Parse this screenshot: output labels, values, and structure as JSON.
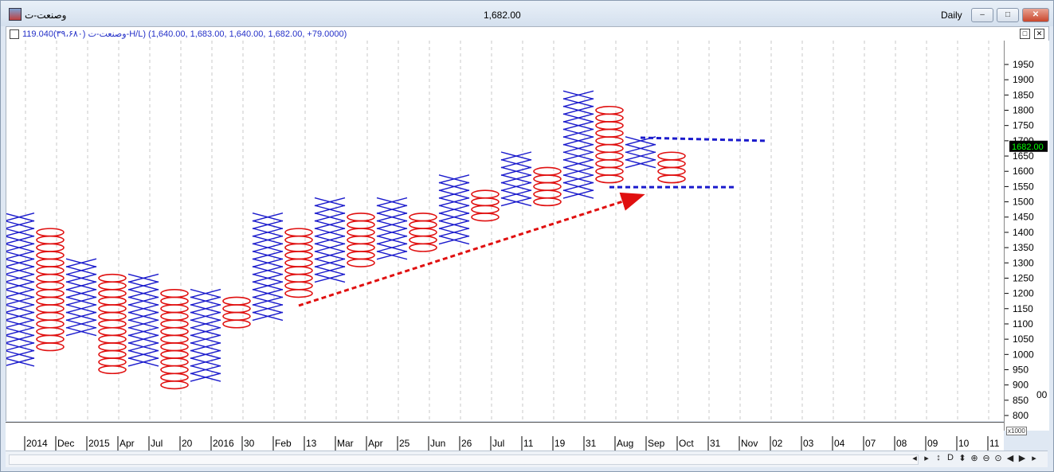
{
  "window": {
    "symbol": "وصنعت-ت",
    "last_price": "1,682.00",
    "period": "Daily",
    "buttons": {
      "minimize": "–",
      "maximize": "□",
      "close": "✕"
    }
  },
  "infobar": {
    "text": "وصنعت-ت (۳۹،۶۸۰)119.040-H/L) (1,640.00, 1,683.00, 1,640.00, 1,682.00, +79.0000)",
    "maximize": "□",
    "close": "✕"
  },
  "scale_badge": "x1000",
  "scroll_controls": [
    "◂",
    "▸",
    "↕",
    "D",
    "⬍",
    "⊕",
    "⊖",
    "⊙",
    "◀",
    "▶",
    "▸"
  ],
  "colors": {
    "x": "#1a1acc",
    "o": "#e01010",
    "trend_arrow": "#e01010",
    "support_line": "#1a1acc",
    "price_tag_bg": "#000000",
    "price_tag_fg": "#00ff00"
  },
  "chart_data": {
    "type": "point-and-figure",
    "box_size": 25,
    "y_axis": {
      "ticks": [
        800,
        850,
        900,
        950,
        1000,
        1050,
        1100,
        1150,
        1200,
        1250,
        1300,
        1350,
        1400,
        1450,
        1500,
        1550,
        1600,
        1650,
        1700,
        1750,
        1800,
        1850,
        1900,
        1950
      ],
      "lower_panel_tick": "00",
      "current_price_label": "1682.00",
      "current_price": 1682
    },
    "x_axis_labels": [
      "2014",
      "Dec",
      "2015",
      "Apr",
      "Jul",
      "20",
      "2016",
      "30",
      "Feb",
      "13",
      "Mar",
      "Apr",
      "25",
      "Jun",
      "26",
      "Jul",
      "11",
      "19",
      "31",
      "Aug",
      "Sep",
      "Oct",
      "31",
      "Nov",
      "02",
      "03",
      "04",
      "07",
      "08",
      "09",
      "10",
      "11"
    ],
    "columns": [
      {
        "type": "X",
        "low": 975,
        "high": 1450
      },
      {
        "type": "O",
        "low": 1025,
        "high": 1400
      },
      {
        "type": "X",
        "low": 1075,
        "high": 1300
      },
      {
        "type": "O",
        "low": 950,
        "high": 1250
      },
      {
        "type": "X",
        "low": 975,
        "high": 1250
      },
      {
        "type": "O",
        "low": 900,
        "high": 1200
      },
      {
        "type": "X",
        "low": 925,
        "high": 1200
      },
      {
        "type": "O",
        "low": 1100,
        "high": 1175
      },
      {
        "type": "X",
        "low": 1125,
        "high": 1450
      },
      {
        "type": "O",
        "low": 1200,
        "high": 1400
      },
      {
        "type": "X",
        "low": 1250,
        "high": 1500
      },
      {
        "type": "O",
        "low": 1300,
        "high": 1450
      },
      {
        "type": "X",
        "low": 1325,
        "high": 1500
      },
      {
        "type": "O",
        "low": 1350,
        "high": 1450
      },
      {
        "type": "X",
        "low": 1375,
        "high": 1575
      },
      {
        "type": "O",
        "low": 1450,
        "high": 1525
      },
      {
        "type": "X",
        "low": 1500,
        "high": 1650
      },
      {
        "type": "O",
        "low": 1500,
        "high": 1600
      },
      {
        "type": "X",
        "low": 1525,
        "high": 1850
      },
      {
        "type": "O",
        "low": 1575,
        "high": 1800
      },
      {
        "type": "X",
        "low": 1625,
        "high": 1700
      },
      {
        "type": "O",
        "low": 1575,
        "high": 1650
      }
    ],
    "annotations": [
      {
        "kind": "arrow",
        "color": "red",
        "style": "dashed",
        "from": {
          "col": 9,
          "price": 1160
        },
        "to": {
          "col": 20,
          "price": 1520
        }
      },
      {
        "kind": "line",
        "color": "blue",
        "style": "dashed",
        "from": {
          "col": 20,
          "price": 1710
        },
        "to": {
          "col": 24,
          "price": 1700
        }
      },
      {
        "kind": "line",
        "color": "blue",
        "style": "dashed",
        "from": {
          "col": 19,
          "price": 1548
        },
        "to": {
          "col": 23,
          "price": 1548
        }
      }
    ]
  }
}
